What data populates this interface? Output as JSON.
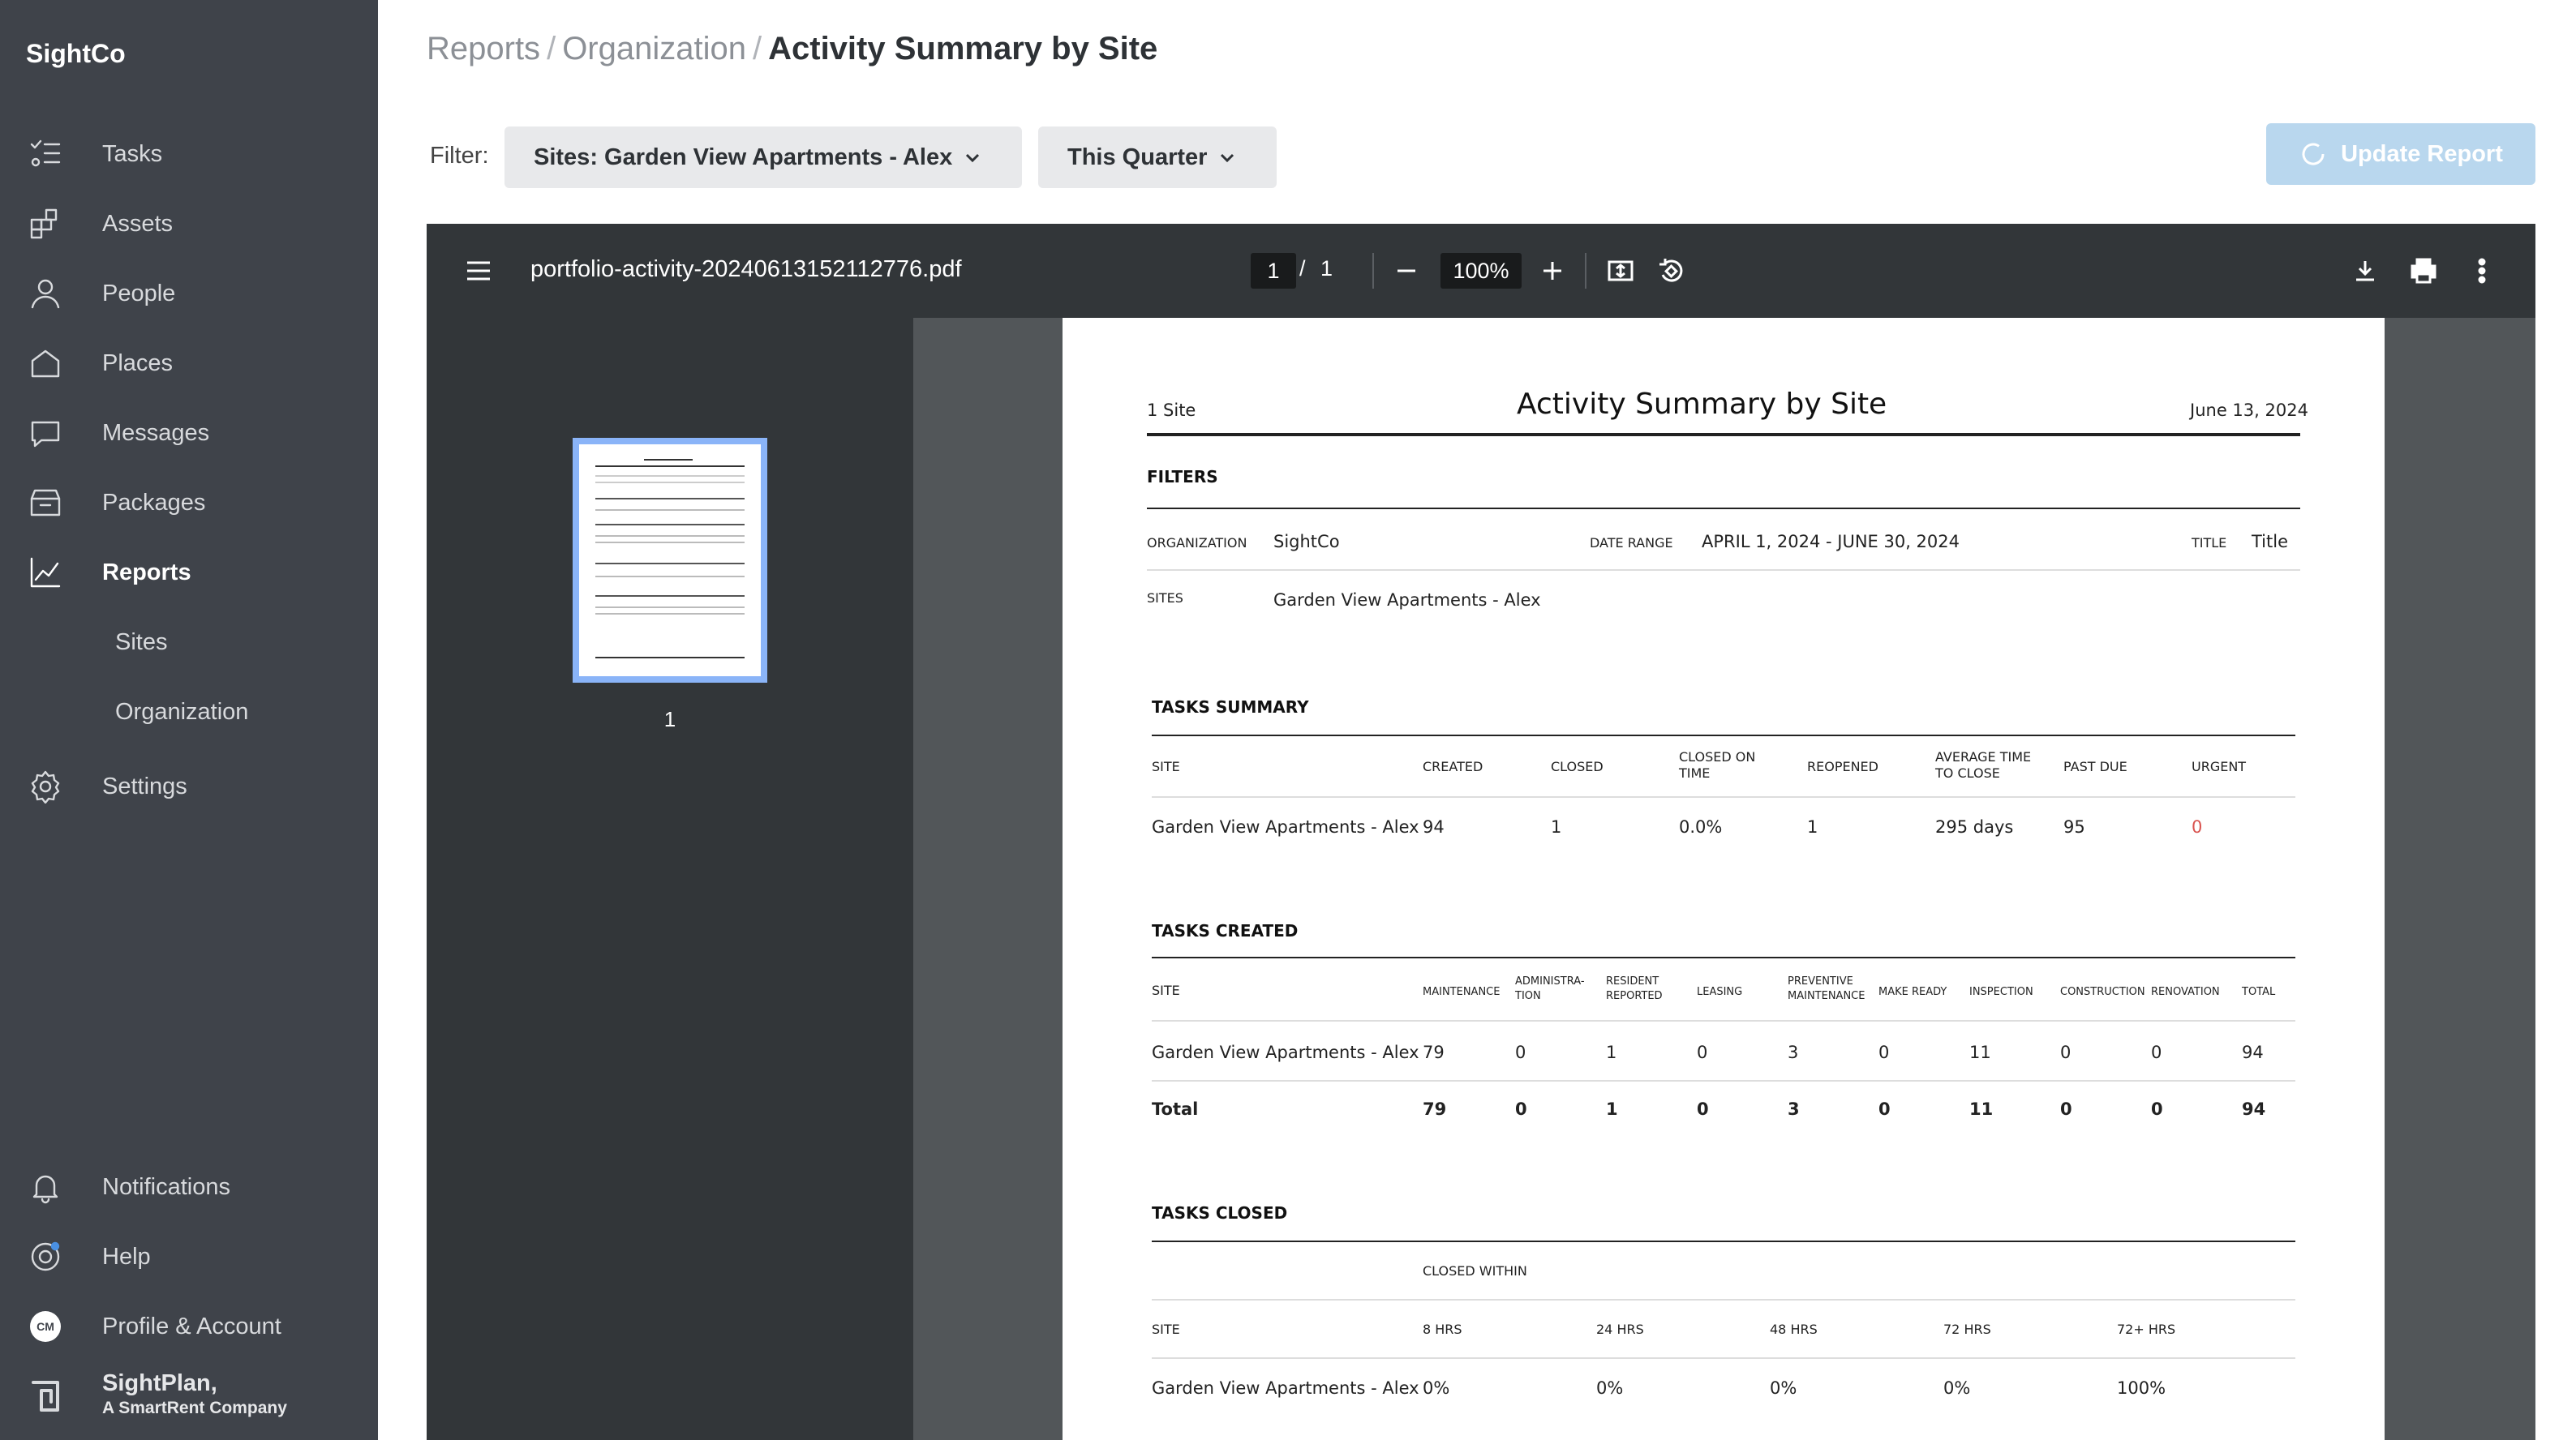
{
  "sidebar": {
    "brand": "SightCo",
    "items": [
      {
        "label": "Tasks"
      },
      {
        "label": "Assets"
      },
      {
        "label": "People"
      },
      {
        "label": "Places"
      },
      {
        "label": "Messages"
      },
      {
        "label": "Packages"
      },
      {
        "label": "Reports"
      },
      {
        "label": "Settings"
      }
    ],
    "sub_items": [
      "Sites",
      "Organization"
    ],
    "bottom": [
      {
        "label": "Notifications"
      },
      {
        "label": "Help"
      },
      {
        "label": "Profile & Account",
        "avatar": "CM"
      }
    ],
    "company": {
      "line1": "SightPlan,",
      "line2": "A SmartRent Company"
    }
  },
  "header": {
    "breadcrumb": [
      "Reports",
      "Organization",
      "Activity Summary by Site"
    ],
    "filter_label": "Filter:",
    "sites_filter": "Sites: Garden View Apartments - Alex",
    "period_filter": "This Quarter",
    "update_button": "Update Report"
  },
  "viewer": {
    "file_name": "portfolio-activity-20240613152112776.pdf",
    "page_current": "1",
    "page_total": "1",
    "zoom": "100%",
    "thumb_label": "1"
  },
  "report": {
    "site_count": "1 Site",
    "title": "Activity Summary by Site",
    "date": "June 13, 2024",
    "filters_heading": "FILTERS",
    "org_label": "ORGANIZATION",
    "org_value": "SightCo",
    "range_label": "DATE RANGE",
    "range_value": "APRIL 1, 2024 - JUNE 30, 2024",
    "title_label": "TITLE",
    "title_value": "Title",
    "sites_label": "SITES",
    "sites_value": "Garden View Apartments - Alex",
    "summary": {
      "heading": "TASKS SUMMARY",
      "headers": [
        "SITE",
        "CREATED",
        "CLOSED",
        "CLOSED ON TIME",
        "REOPENED",
        "AVERAGE TIME TO CLOSE",
        "PAST DUE",
        "URGENT"
      ],
      "row": [
        "Garden View Apartments - Alex",
        "94",
        "1",
        "0.0%",
        "1",
        "295 days",
        "95",
        "0"
      ]
    },
    "created": {
      "heading": "TASKS CREATED",
      "headers": [
        "SITE",
        "MAINTENANCE",
        "ADMINISTRA-TION",
        "RESIDENT REPORTED",
        "LEASING",
        "PREVENTIVE MAINTENANCE",
        "MAKE READY",
        "INSPECTION",
        "CONSTRUCTION",
        "RENOVATION",
        "TOTAL"
      ],
      "row": [
        "Garden View Apartments - Alex",
        "79",
        "0",
        "1",
        "0",
        "3",
        "0",
        "11",
        "0",
        "0",
        "94"
      ],
      "total": [
        "Total",
        "79",
        "0",
        "1",
        "0",
        "3",
        "0",
        "11",
        "0",
        "0",
        "94"
      ]
    },
    "closed": {
      "heading": "TASKS CLOSED",
      "group": "CLOSED WITHIN",
      "headers": [
        "SITE",
        "8 HRS",
        "24 HRS",
        "48 HRS",
        "72 HRS",
        "72+ HRS"
      ],
      "row": [
        "Garden View Apartments - Alex",
        "0%",
        "0%",
        "0%",
        "0%",
        "100%"
      ]
    }
  }
}
